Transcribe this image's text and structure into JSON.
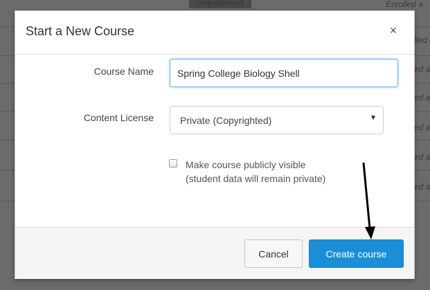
{
  "background": {
    "badge": "Unpublished",
    "status_rows": [
      "Enrolled a",
      "lled a",
      "ed a",
      "ed a",
      "ed a",
      "ed a",
      "ed a"
    ]
  },
  "modal": {
    "title": "Start a New Course",
    "close_icon": "×",
    "course_name": {
      "label": "Course Name",
      "value": "Spring College Biology Shell"
    },
    "content_license": {
      "label": "Content License",
      "selected": "Private (Copyrighted)",
      "caret_icon": "▼"
    },
    "public_checkbox": {
      "checked": false,
      "label_line1": "Make course publicly visible",
      "label_line2": "(student data will remain private)"
    },
    "footer": {
      "cancel_label": "Cancel",
      "create_label": "Create course"
    }
  },
  "annotation": {
    "type": "arrow",
    "color": "#000000",
    "points_to": "create-course-button"
  }
}
